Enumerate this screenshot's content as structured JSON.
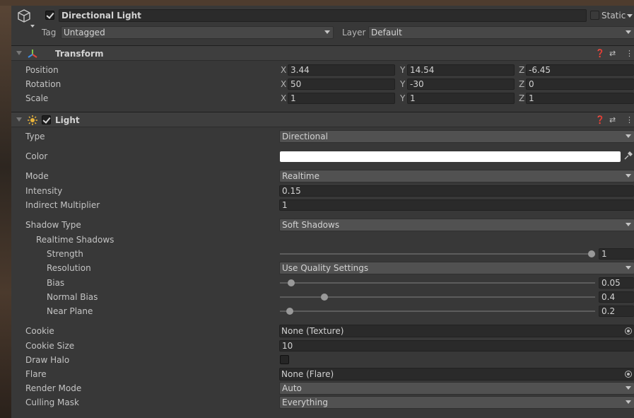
{
  "header": {
    "object_name": "Directional Light",
    "active": true,
    "static_label": "Static",
    "tag_label": "Tag",
    "tag_value": "Untagged",
    "layer_label": "Layer",
    "layer_value": "Default",
    "gameobject_icon": "cube-icon"
  },
  "transform": {
    "title": "Transform",
    "icon": "transform-axes-icon",
    "position": {
      "label": "Position",
      "x": "3.44",
      "y": "14.54",
      "z": "-6.45"
    },
    "rotation": {
      "label": "Rotation",
      "x": "50",
      "y": "-30",
      "z": "0"
    },
    "scale": {
      "label": "Scale",
      "x": "1",
      "y": "1",
      "z": "1"
    },
    "axis_x": "X",
    "axis_y": "Y",
    "axis_z": "Z"
  },
  "light": {
    "title": "Light",
    "enabled": true,
    "icon": "light-icon",
    "type": {
      "label": "Type",
      "value": "Directional"
    },
    "color": {
      "label": "Color",
      "value": "#ffffff"
    },
    "mode": {
      "label": "Mode",
      "value": "Realtime"
    },
    "intensity": {
      "label": "Intensity",
      "value": "0.15"
    },
    "indirect_multiplier": {
      "label": "Indirect Multiplier",
      "value": "1"
    },
    "shadow_type": {
      "label": "Shadow Type",
      "value": "Soft Shadows"
    },
    "realtime_shadows_label": "Realtime Shadows",
    "strength": {
      "label": "Strength",
      "value": "1",
      "fraction": 1.0
    },
    "resolution": {
      "label": "Resolution",
      "value": "Use Quality Settings"
    },
    "bias": {
      "label": "Bias",
      "value": "0.05",
      "fraction": 0.025
    },
    "normal_bias": {
      "label": "Normal Bias",
      "value": "0.4",
      "fraction": 0.133
    },
    "near_plane": {
      "label": "Near Plane",
      "value": "0.2",
      "fraction": 0.02
    },
    "cookie": {
      "label": "Cookie",
      "value": "None (Texture)"
    },
    "cookie_size": {
      "label": "Cookie Size",
      "value": "10"
    },
    "draw_halo": {
      "label": "Draw Halo",
      "checked": false
    },
    "flare": {
      "label": "Flare",
      "value": "None (Flare)"
    },
    "render_mode": {
      "label": "Render Mode",
      "value": "Auto"
    },
    "culling_mask": {
      "label": "Culling Mask",
      "value": "Everything"
    }
  },
  "icons": {
    "help": "help-icon",
    "presets": "presets-icon",
    "menu": "kebab-menu-icon",
    "eyedropper": "eyedropper-icon",
    "object_picker": "object-picker-icon"
  }
}
